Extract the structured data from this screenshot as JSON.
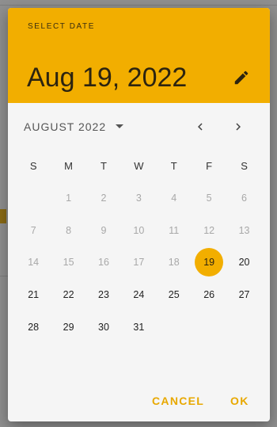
{
  "header": {
    "label": "SELECT DATE",
    "selected_date": "Aug 19, 2022",
    "edit_icon": "pencil-icon"
  },
  "calendar": {
    "month_label": "AUGUST 2022",
    "dropdown_icon": "triangle-down-icon",
    "prev_icon": "chevron-left-icon",
    "next_icon": "chevron-right-icon",
    "weekdays": [
      "S",
      "M",
      "T",
      "W",
      "T",
      "F",
      "S"
    ],
    "weeks": [
      [
        "",
        "1",
        "2",
        "3",
        "4",
        "5",
        "6"
      ],
      [
        "7",
        "8",
        "9",
        "10",
        "11",
        "12",
        "13"
      ],
      [
        "14",
        "15",
        "16",
        "17",
        "18",
        "19",
        "20"
      ],
      [
        "21",
        "22",
        "23",
        "24",
        "25",
        "26",
        "27"
      ],
      [
        "28",
        "29",
        "30",
        "31",
        "",
        "",
        ""
      ]
    ],
    "selected_day": "19",
    "last_disabled_day": 18
  },
  "actions": {
    "cancel_label": "CANCEL",
    "ok_label": "OK"
  },
  "colors": {
    "accent": "#f2ae00",
    "dialog_bg": "#f5f5f5",
    "scrim": "#8f8f8f",
    "disabled_text": "#a8a8a8"
  }
}
